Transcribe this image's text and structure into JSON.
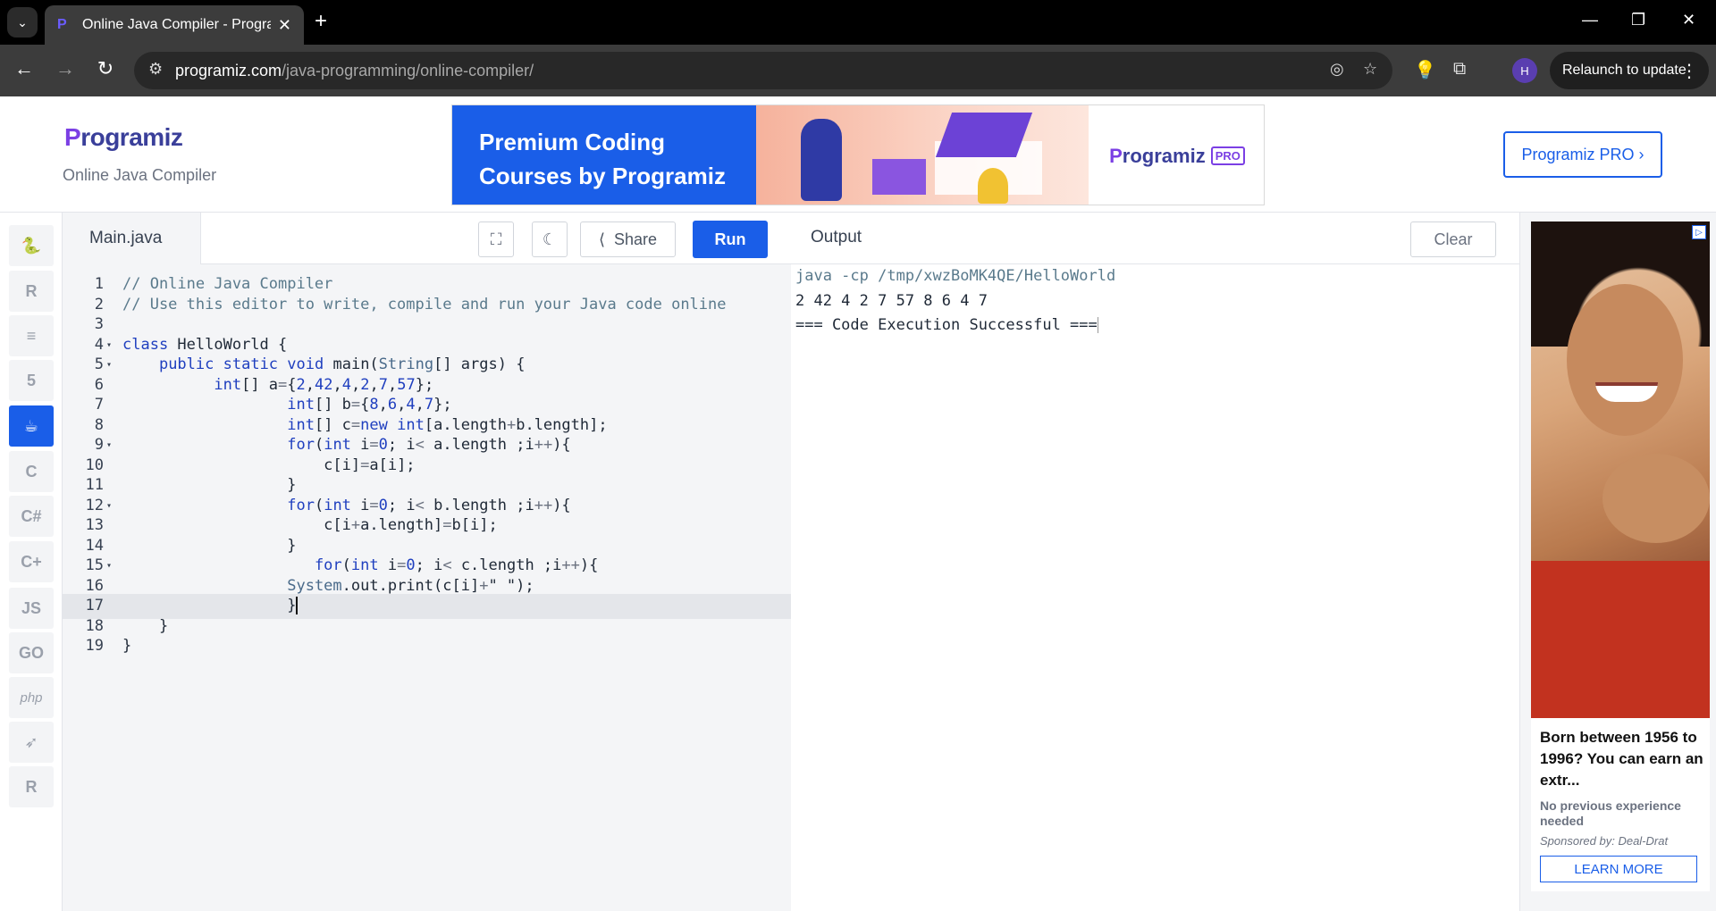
{
  "browser": {
    "tab_title": "Online Java Compiler - Programiz",
    "url_host": "programiz.com",
    "url_path": "/java-programming/online-compiler/",
    "relaunch_label": "Relaunch to update",
    "profile_initial": "H"
  },
  "header": {
    "logo_text": "rogramiz",
    "logo_p": "P",
    "subtitle": "Online Java Compiler",
    "banner_headline_1": "Premium Coding",
    "banner_headline_2": "Courses by Programiz",
    "banner_brand": "rogramiz",
    "banner_brand_p": "P",
    "banner_pro": "PRO",
    "pro_button": "Programiz PRO ›"
  },
  "sidebar": {
    "items": [
      {
        "name": "python",
        "glyph": "🐍"
      },
      {
        "name": "r",
        "glyph": "R"
      },
      {
        "name": "sql",
        "glyph": "≡"
      },
      {
        "name": "html",
        "glyph": "5"
      },
      {
        "name": "java",
        "glyph": "☕"
      },
      {
        "name": "c",
        "glyph": "C"
      },
      {
        "name": "csharp",
        "glyph": "C#"
      },
      {
        "name": "cpp",
        "glyph": "C+"
      },
      {
        "name": "javascript",
        "glyph": "JS"
      },
      {
        "name": "go",
        "glyph": "GO"
      },
      {
        "name": "php",
        "glyph": "php"
      },
      {
        "name": "swift",
        "glyph": "➶"
      },
      {
        "name": "rust",
        "glyph": "R"
      }
    ]
  },
  "editor": {
    "file_name": "Main.java",
    "share_label": "Share",
    "run_label": "Run",
    "lines": [
      "// Online Java Compiler",
      "// Use this editor to write, compile and run your Java code online",
      "",
      "class HelloWorld {",
      "    public static void main(String[] args) {",
      "          int[] a={2,42,4,2,7,57};",
      "                  int[] b={8,6,4,7};",
      "                  int[] c=new int[a.length+b.length];",
      "                  for(int i=0; i< a.length ;i++){",
      "                      c[i]=a[i];",
      "                  }",
      "                  for(int i=0; i< b.length ;i++){",
      "                      c[i+a.length]=b[i];",
      "                  }",
      "                     for(int i=0; i< c.length ;i++){",
      "                  System.out.print(c[i]+\" \");",
      "                  }",
      "    }",
      "}"
    ]
  },
  "output": {
    "title": "Output",
    "clear_label": "Clear",
    "lines": [
      "java -cp /tmp/xwzBoMK4QE/HelloWorld",
      "2 42 4 2 7 57 8 6 4 7",
      "=== Code Execution Successful ==="
    ]
  },
  "ad": {
    "headline": "Born between 1956 to 1996? You can earn an extr...",
    "sub": "No previous experience needed",
    "sponsor": "Sponsored by: Deal-Drat",
    "cta": "LEARN MORE"
  }
}
